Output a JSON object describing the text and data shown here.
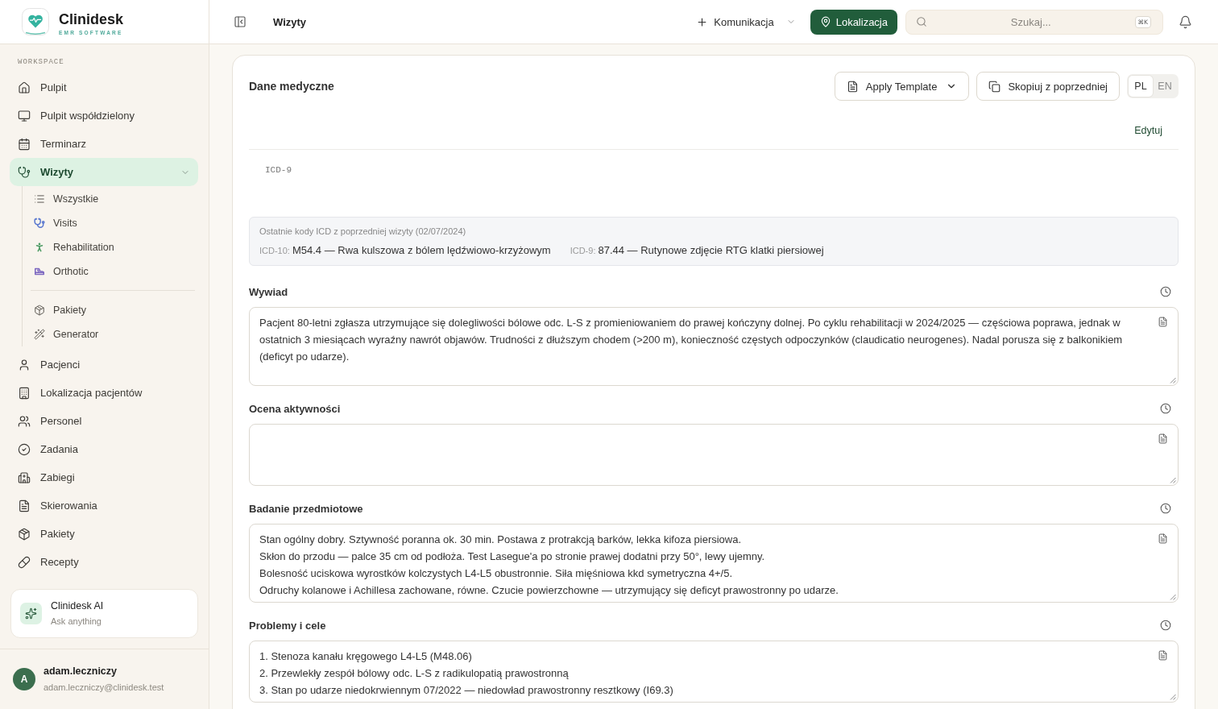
{
  "brand": {
    "name": "Clinidesk",
    "tagline": "EMR SOFTWARE"
  },
  "sidebar": {
    "section_label": "WORKSPACE",
    "items": [
      {
        "label": "Pulpit",
        "selected": false
      },
      {
        "label": "Pulpit współdzielony",
        "selected": false
      },
      {
        "label": "Terminarz",
        "selected": false
      },
      {
        "label": "Wizyty",
        "selected": true,
        "expanded": true,
        "child_groups": [
          {
            "items": [
              {
                "label": "Wszystkie",
                "selected": false
              },
              {
                "label": "Visits",
                "selected": false,
                "color": "#5a78cf"
              },
              {
                "label": "Rehabilitation",
                "selected": false,
                "color": "#4c9a63"
              },
              {
                "label": "Orthotic",
                "selected": false,
                "color": "#7b66c0"
              }
            ]
          },
          {
            "items": [
              {
                "label": "Pakiety",
                "selected": false
              },
              {
                "label": "Generator",
                "selected": false
              }
            ]
          }
        ]
      },
      {
        "label": "Pacjenci",
        "selected": false
      },
      {
        "label": "Lokalizacja pacjentów",
        "selected": false
      },
      {
        "label": "Personel",
        "selected": false
      },
      {
        "label": "Zadania",
        "selected": false
      },
      {
        "label": "Zabiegi",
        "selected": false
      },
      {
        "label": "Skierowania",
        "selected": false
      },
      {
        "label": "Pakiety",
        "selected": false
      },
      {
        "label": "Recepty",
        "selected": false
      }
    ],
    "assistant": {
      "title": "Clinidesk AI",
      "subtitle": "Ask anything"
    },
    "user": {
      "initial": "A",
      "name": "adam.leczniczy",
      "email": "adam.leczniczy@clinidesk.test"
    }
  },
  "topbar": {
    "title": "Wizyty",
    "communication_button": "Komunikacja",
    "location_button": "Lokalizacja",
    "search": {
      "placeholder": "Szukaj...",
      "shortcut": "⌘K"
    }
  },
  "medical_data": {
    "title": "Dane medyczne",
    "template_button": "Apply Template",
    "copy_button": "Skopiuj z poprzedniej",
    "languages": [
      {
        "label": "PL",
        "selected": true
      },
      {
        "label": "EN",
        "selected": false
      }
    ],
    "edit_link": "Edytuj",
    "code_label": "ICD-9",
    "previous_codes": {
      "title": "Ostatnie kody ICD z poprzedniej wizyty (02/07/2024)",
      "codes": [
        {
          "system": "ICD-10:",
          "text": "M54.4 — Rwa kulszowa z bólem lędźwiowo-krzyżowym"
        },
        {
          "system": "ICD-9:",
          "text": "87.44 — Rutynowe zdjęcie RTG klatki piersiowej"
        }
      ]
    },
    "sections": [
      {
        "label": "Wywiad",
        "value": "Pacjent 80-letni zgłasza utrzymujące się dolegliwości bólowe odc. L-S z promieniowaniem do prawej kończyny dolnej. Po cyklu rehabilitacji w 2024/2025 — częściowa poprawa, jednak w ostatnich 3 miesiącach wyraźny nawrót objawów. Trudności z dłuższym chodem (>200 m), konieczność częstych odpoczynków (claudicatio neurogenes). Nadal porusza się z balkonikiem (deficyt po udarze)."
      },
      {
        "label": "Ocena aktywności"
      },
      {
        "label": "Badanie przedmiotowe",
        "value": "Stan ogólny dobry. Sztywność poranna ok. 30 min. Postawa z protrakcją barków, lekka kifoza piersiowa.\nSkłon do przodu — palce 35 cm od podłoża. Test Lasegue'a po stronie prawej dodatni przy 50°, lewy ujemny.\nBolesność uciskowa wyrostków kolczystych L4-L5 obustronnie. Siła mięśniowa kkd symetryczna 4+/5.\nOdruchy kolanowe i Achillesa zachowane, równe. Czucie powierzchowne — utrzymujący się deficyt prawostronny po udarze."
      },
      {
        "label": "Problemy i cele",
        "value": "1. Stenoza kanału kręgowego L4-L5 (M48.06)\n2. Przewlekły zespół bólowy odc. L-S z radikulopatią prawostronną\n3. Stan po udarze niedokrwiennym 07/2022 — niedowład prawostronny resztkowy (I69.3)"
      }
    ]
  }
}
